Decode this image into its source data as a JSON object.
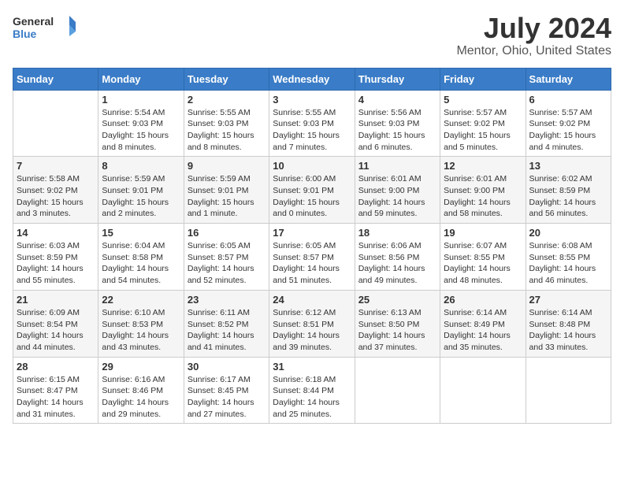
{
  "logo": {
    "text_general": "General",
    "text_blue": "Blue"
  },
  "title": "July 2024",
  "subtitle": "Mentor, Ohio, United States",
  "days_header": [
    "Sunday",
    "Monday",
    "Tuesday",
    "Wednesday",
    "Thursday",
    "Friday",
    "Saturday"
  ],
  "weeks": [
    [
      {
        "day": "",
        "info": ""
      },
      {
        "day": "1",
        "info": "Sunrise: 5:54 AM\nSunset: 9:03 PM\nDaylight: 15 hours\nand 8 minutes."
      },
      {
        "day": "2",
        "info": "Sunrise: 5:55 AM\nSunset: 9:03 PM\nDaylight: 15 hours\nand 8 minutes."
      },
      {
        "day": "3",
        "info": "Sunrise: 5:55 AM\nSunset: 9:03 PM\nDaylight: 15 hours\nand 7 minutes."
      },
      {
        "day": "4",
        "info": "Sunrise: 5:56 AM\nSunset: 9:03 PM\nDaylight: 15 hours\nand 6 minutes."
      },
      {
        "day": "5",
        "info": "Sunrise: 5:57 AM\nSunset: 9:02 PM\nDaylight: 15 hours\nand 5 minutes."
      },
      {
        "day": "6",
        "info": "Sunrise: 5:57 AM\nSunset: 9:02 PM\nDaylight: 15 hours\nand 4 minutes."
      }
    ],
    [
      {
        "day": "7",
        "info": "Sunrise: 5:58 AM\nSunset: 9:02 PM\nDaylight: 15 hours\nand 3 minutes."
      },
      {
        "day": "8",
        "info": "Sunrise: 5:59 AM\nSunset: 9:01 PM\nDaylight: 15 hours\nand 2 minutes."
      },
      {
        "day": "9",
        "info": "Sunrise: 5:59 AM\nSunset: 9:01 PM\nDaylight: 15 hours\nand 1 minute."
      },
      {
        "day": "10",
        "info": "Sunrise: 6:00 AM\nSunset: 9:01 PM\nDaylight: 15 hours\nand 0 minutes."
      },
      {
        "day": "11",
        "info": "Sunrise: 6:01 AM\nSunset: 9:00 PM\nDaylight: 14 hours\nand 59 minutes."
      },
      {
        "day": "12",
        "info": "Sunrise: 6:01 AM\nSunset: 9:00 PM\nDaylight: 14 hours\nand 58 minutes."
      },
      {
        "day": "13",
        "info": "Sunrise: 6:02 AM\nSunset: 8:59 PM\nDaylight: 14 hours\nand 56 minutes."
      }
    ],
    [
      {
        "day": "14",
        "info": "Sunrise: 6:03 AM\nSunset: 8:59 PM\nDaylight: 14 hours\nand 55 minutes."
      },
      {
        "day": "15",
        "info": "Sunrise: 6:04 AM\nSunset: 8:58 PM\nDaylight: 14 hours\nand 54 minutes."
      },
      {
        "day": "16",
        "info": "Sunrise: 6:05 AM\nSunset: 8:57 PM\nDaylight: 14 hours\nand 52 minutes."
      },
      {
        "day": "17",
        "info": "Sunrise: 6:05 AM\nSunset: 8:57 PM\nDaylight: 14 hours\nand 51 minutes."
      },
      {
        "day": "18",
        "info": "Sunrise: 6:06 AM\nSunset: 8:56 PM\nDaylight: 14 hours\nand 49 minutes."
      },
      {
        "day": "19",
        "info": "Sunrise: 6:07 AM\nSunset: 8:55 PM\nDaylight: 14 hours\nand 48 minutes."
      },
      {
        "day": "20",
        "info": "Sunrise: 6:08 AM\nSunset: 8:55 PM\nDaylight: 14 hours\nand 46 minutes."
      }
    ],
    [
      {
        "day": "21",
        "info": "Sunrise: 6:09 AM\nSunset: 8:54 PM\nDaylight: 14 hours\nand 44 minutes."
      },
      {
        "day": "22",
        "info": "Sunrise: 6:10 AM\nSunset: 8:53 PM\nDaylight: 14 hours\nand 43 minutes."
      },
      {
        "day": "23",
        "info": "Sunrise: 6:11 AM\nSunset: 8:52 PM\nDaylight: 14 hours\nand 41 minutes."
      },
      {
        "day": "24",
        "info": "Sunrise: 6:12 AM\nSunset: 8:51 PM\nDaylight: 14 hours\nand 39 minutes."
      },
      {
        "day": "25",
        "info": "Sunrise: 6:13 AM\nSunset: 8:50 PM\nDaylight: 14 hours\nand 37 minutes."
      },
      {
        "day": "26",
        "info": "Sunrise: 6:14 AM\nSunset: 8:49 PM\nDaylight: 14 hours\nand 35 minutes."
      },
      {
        "day": "27",
        "info": "Sunrise: 6:14 AM\nSunset: 8:48 PM\nDaylight: 14 hours\nand 33 minutes."
      }
    ],
    [
      {
        "day": "28",
        "info": "Sunrise: 6:15 AM\nSunset: 8:47 PM\nDaylight: 14 hours\nand 31 minutes."
      },
      {
        "day": "29",
        "info": "Sunrise: 6:16 AM\nSunset: 8:46 PM\nDaylight: 14 hours\nand 29 minutes."
      },
      {
        "day": "30",
        "info": "Sunrise: 6:17 AM\nSunset: 8:45 PM\nDaylight: 14 hours\nand 27 minutes."
      },
      {
        "day": "31",
        "info": "Sunrise: 6:18 AM\nSunset: 8:44 PM\nDaylight: 14 hours\nand 25 minutes."
      },
      {
        "day": "",
        "info": ""
      },
      {
        "day": "",
        "info": ""
      },
      {
        "day": "",
        "info": ""
      }
    ]
  ]
}
